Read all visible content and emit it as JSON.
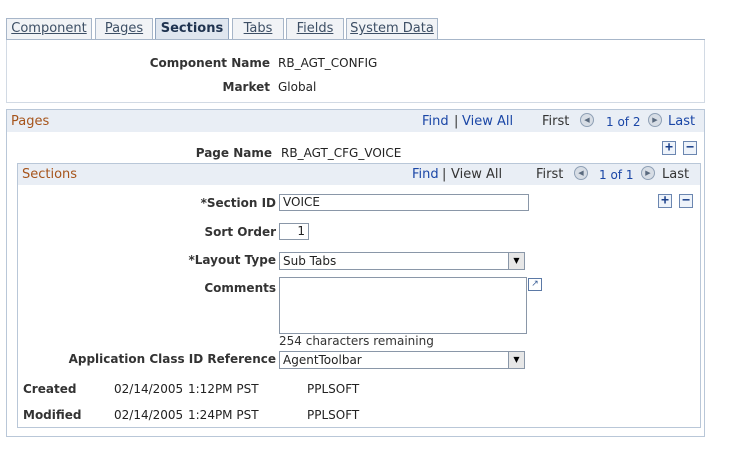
{
  "tabs": [
    {
      "label": "Component"
    },
    {
      "label": "Pages"
    },
    {
      "label": "Sections"
    },
    {
      "label": "Tabs"
    },
    {
      "label": "Fields"
    },
    {
      "label": "System Data"
    }
  ],
  "header": {
    "component_name_label": "Component Name",
    "component_name_value": "RB_AGT_CONFIG",
    "market_label": "Market",
    "market_value": "Global"
  },
  "pages": {
    "title": "Pages",
    "find": "Find",
    "separator": "|",
    "view_all": "View All",
    "first": "First",
    "count": "1 of 2",
    "last": "Last",
    "page_name_label": "Page Name",
    "page_name_value": "RB_AGT_CFG_VOICE"
  },
  "sections": {
    "title": "Sections",
    "find": "Find",
    "separator": "|",
    "view_all": "View All",
    "first": "First",
    "count": "1 of 1",
    "last": "Last",
    "section_id_label": "*Section ID",
    "section_id_value": "VOICE",
    "sort_order_label": "Sort Order",
    "sort_order_value": "1",
    "layout_type_label": "*Layout Type",
    "layout_type_value": "Sub Tabs",
    "comments_label": "Comments",
    "comments_value": "",
    "chars_remaining": "254 characters remaining",
    "app_class_label": "Application Class ID Reference",
    "app_class_value": "AgentToolbar"
  },
  "audit": {
    "created_label": "Created",
    "created_date": "02/14/2005",
    "created_time": "1:12PM PST",
    "created_by": "PPLSOFT",
    "modified_label": "Modified",
    "modified_date": "02/14/2005",
    "modified_time": "1:24PM PST",
    "modified_by": "PPLSOFT"
  },
  "icons": {
    "plus": "+",
    "minus": "−",
    "prev": "◀",
    "next": "▶",
    "dropdown": "▼",
    "expand": "↗"
  }
}
